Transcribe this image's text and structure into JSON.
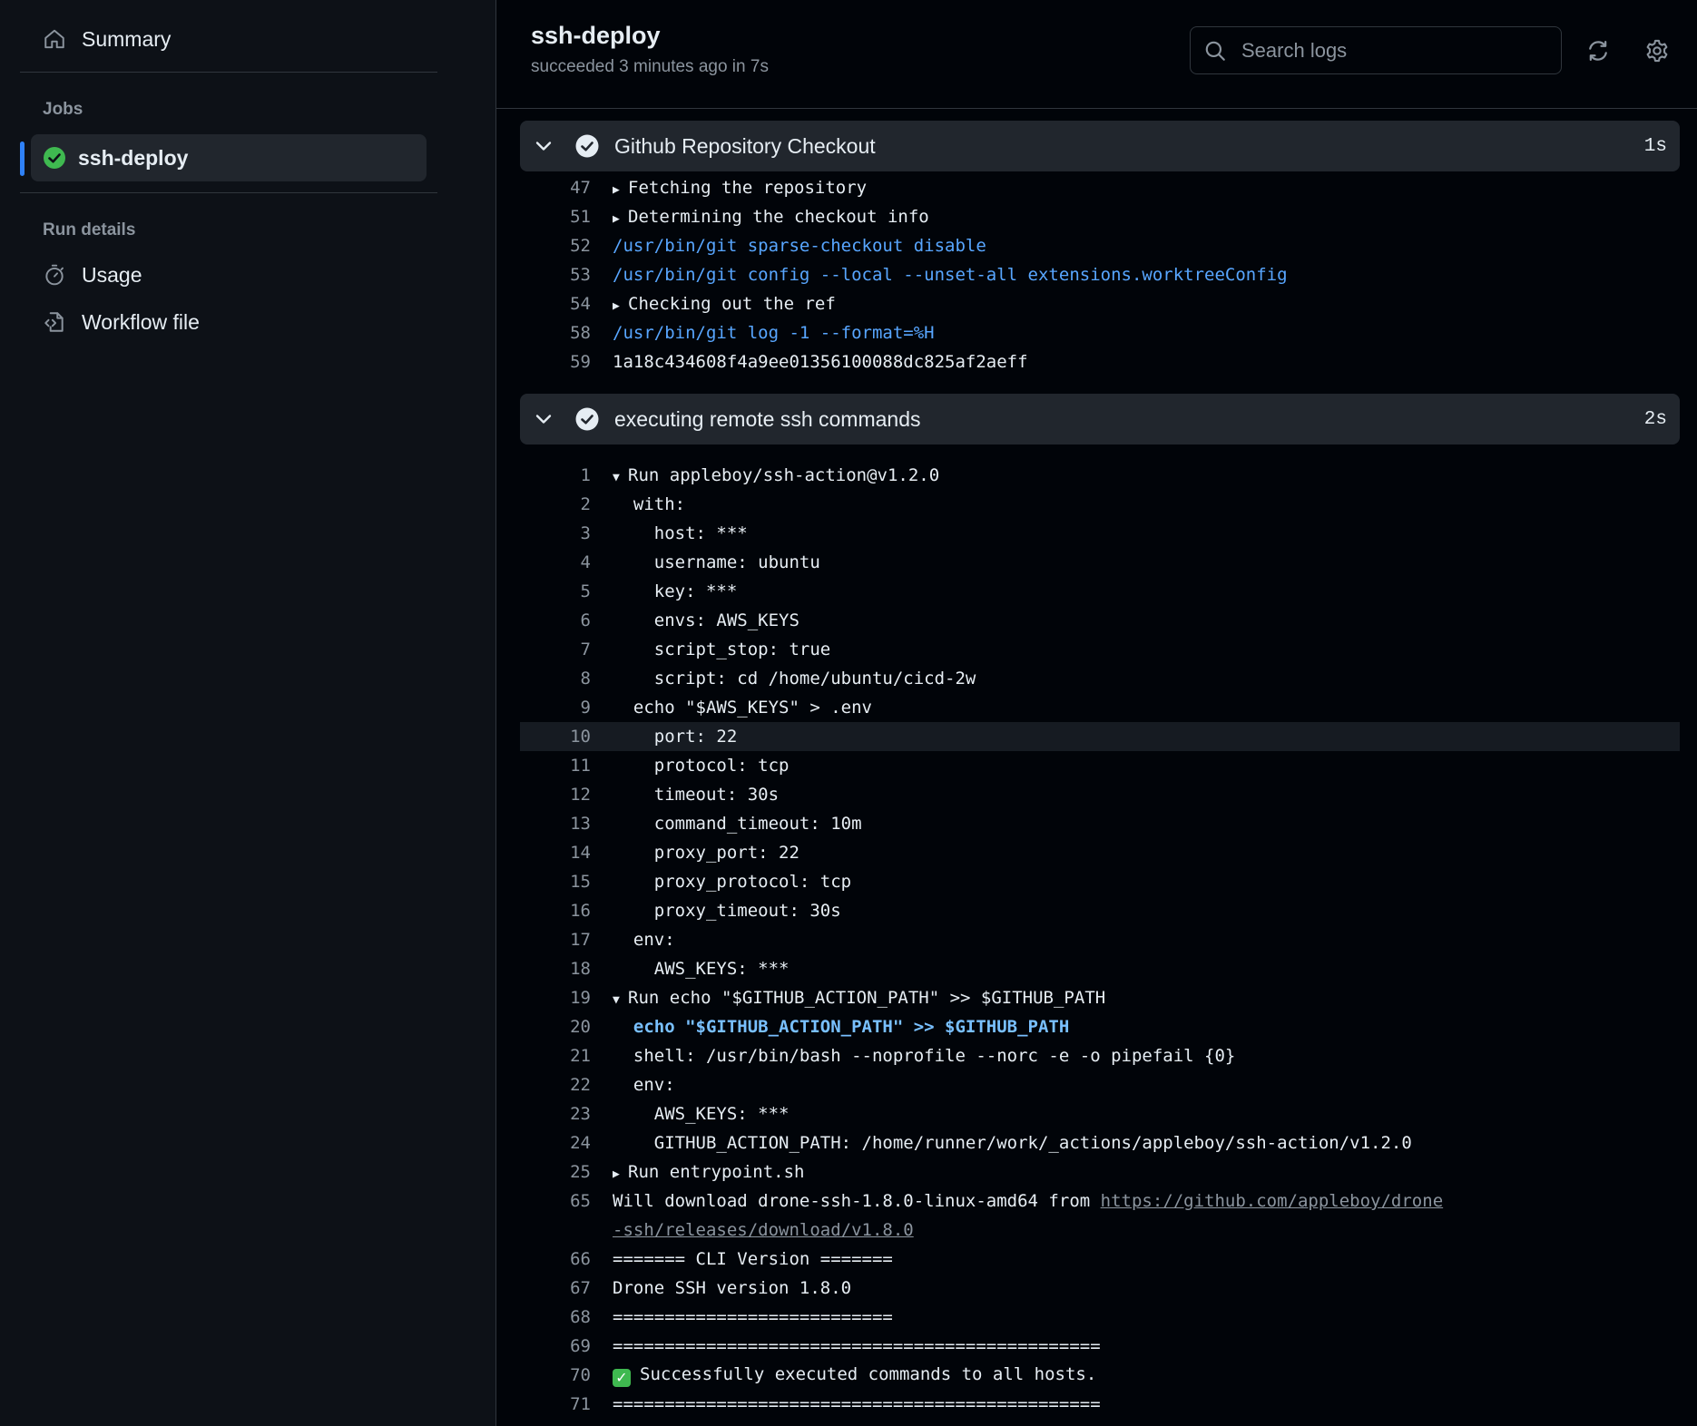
{
  "sidebar": {
    "summary_label": "Summary",
    "jobs_heading": "Jobs",
    "job": {
      "label": "ssh-deploy"
    },
    "run_details_heading": "Run details",
    "usage_label": "Usage",
    "workflow_file_label": "Workflow file"
  },
  "header": {
    "title": "ssh-deploy",
    "status": "succeeded 3 minutes ago in 7s",
    "search_placeholder": "Search logs"
  },
  "steps": [
    {
      "name": "Github Repository Checkout",
      "duration": "1s",
      "lines": [
        {
          "n": "47",
          "text": "Fetching the repository",
          "kind": "collapsed"
        },
        {
          "n": "51",
          "text": "Determining the checkout info",
          "kind": "collapsed"
        },
        {
          "n": "52",
          "text": "/usr/bin/git sparse-checkout disable",
          "kind": "cmd"
        },
        {
          "n": "53",
          "text": "/usr/bin/git config --local --unset-all extensions.worktreeConfig",
          "kind": "cmd"
        },
        {
          "n": "54",
          "text": "Checking out the ref",
          "kind": "collapsed"
        },
        {
          "n": "58",
          "text": "/usr/bin/git log -1 --format=%H",
          "kind": "cmd"
        },
        {
          "n": "59",
          "text": "1a18c434608f4a9ee01356100088dc825af2aeff",
          "kind": "plain"
        }
      ]
    },
    {
      "name": "executing remote ssh commands",
      "duration": "2s",
      "lines": [
        {
          "n": "1",
          "text": "Run appleboy/ssh-action@v1.2.0",
          "kind": "expanded"
        },
        {
          "n": "2",
          "text": "  with:",
          "kind": "plain"
        },
        {
          "n": "3",
          "text": "    host: ***",
          "kind": "plain"
        },
        {
          "n": "4",
          "text": "    username: ubuntu",
          "kind": "plain"
        },
        {
          "n": "5",
          "text": "    key: ***",
          "kind": "plain"
        },
        {
          "n": "6",
          "text": "    envs: AWS_KEYS",
          "kind": "plain"
        },
        {
          "n": "7",
          "text": "    script_stop: true",
          "kind": "plain"
        },
        {
          "n": "8",
          "text": "    script: cd /home/ubuntu/cicd-2w",
          "kind": "plain"
        },
        {
          "n": "9",
          "text": "  echo \"$AWS_KEYS\" > .env",
          "kind": "plain"
        },
        {
          "n": "10",
          "text": "    port: 22",
          "kind": "plain",
          "highlight": true
        },
        {
          "n": "11",
          "text": "    protocol: tcp",
          "kind": "plain"
        },
        {
          "n": "12",
          "text": "    timeout: 30s",
          "kind": "plain"
        },
        {
          "n": "13",
          "text": "    command_timeout: 10m",
          "kind": "plain"
        },
        {
          "n": "14",
          "text": "    proxy_port: 22",
          "kind": "plain"
        },
        {
          "n": "15",
          "text": "    proxy_protocol: tcp",
          "kind": "plain"
        },
        {
          "n": "16",
          "text": "    proxy_timeout: 30s",
          "kind": "plain"
        },
        {
          "n": "17",
          "text": "  env:",
          "kind": "plain"
        },
        {
          "n": "18",
          "text": "    AWS_KEYS: ***",
          "kind": "plain"
        },
        {
          "n": "19",
          "text": "Run echo \"$GITHUB_ACTION_PATH\" >> $GITHUB_PATH",
          "kind": "expanded"
        },
        {
          "n": "20",
          "text": "  echo \"$GITHUB_ACTION_PATH\" >> $GITHUB_PATH",
          "kind": "shell"
        },
        {
          "n": "21",
          "text": "  shell: /usr/bin/bash --noprofile --norc -e -o pipefail {0}",
          "kind": "plain"
        },
        {
          "n": "22",
          "text": "  env:",
          "kind": "plain"
        },
        {
          "n": "23",
          "text": "    AWS_KEYS: ***",
          "kind": "plain"
        },
        {
          "n": "24",
          "text": "    GITHUB_ACTION_PATH: /home/runner/work/_actions/appleboy/ssh-action/v1.2.0",
          "kind": "plain"
        },
        {
          "n": "25",
          "text": "Run entrypoint.sh",
          "kind": "collapsed"
        },
        {
          "n": "65",
          "text": "Will download drone-ssh-1.8.0-linux-amd64 from ",
          "link": "https://github.com/appleboy/drone-ssh/releases/download/v1.8.0",
          "kind": "link"
        },
        {
          "n": "66",
          "text": "======= CLI Version =======",
          "kind": "plain"
        },
        {
          "n": "67",
          "text": "Drone SSH version 1.8.0",
          "kind": "plain"
        },
        {
          "n": "68",
          "text": "===========================",
          "kind": "plain"
        },
        {
          "n": "69",
          "text": "===============================================",
          "kind": "plain"
        },
        {
          "n": "70",
          "text": "Successfully executed commands to all hosts.",
          "kind": "success"
        },
        {
          "n": "71",
          "text": "===============================================",
          "kind": "plain"
        }
      ]
    }
  ],
  "colors": {
    "accent": "#2f81f7",
    "success": "#3fb950",
    "command_blue": "#58a6ff"
  }
}
